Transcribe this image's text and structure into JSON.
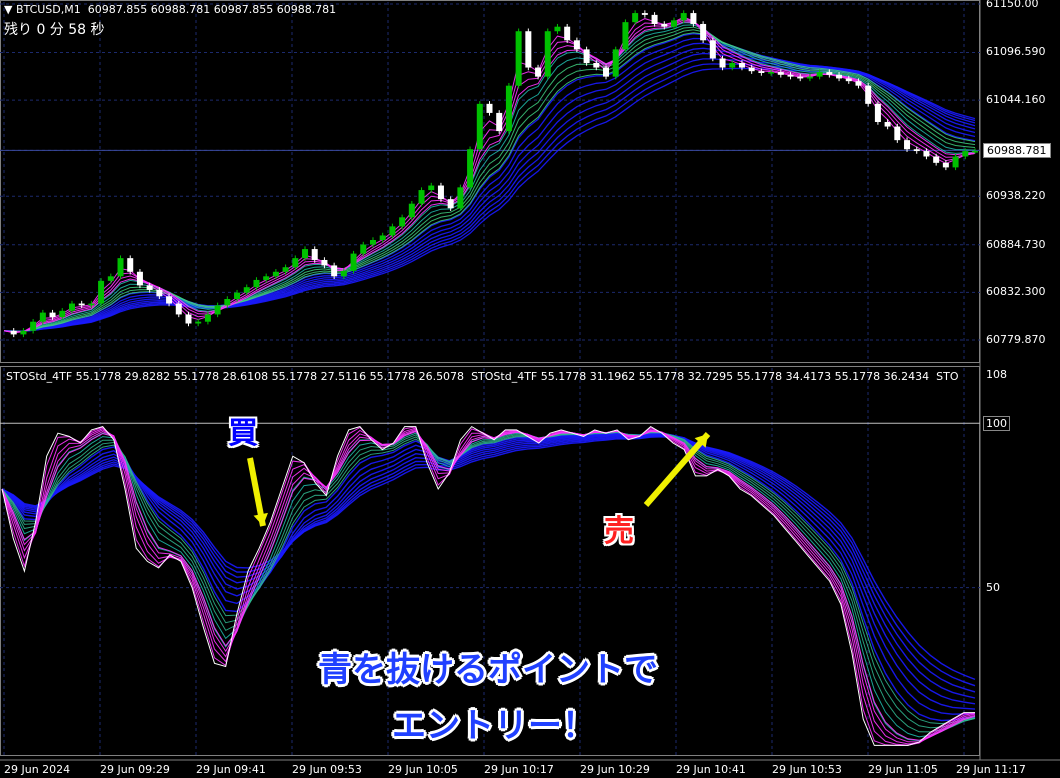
{
  "header": {
    "symbol": "▼ BTCUSD,M1",
    "ohlc": "60987.855 60988.781 60987.855 60988.781",
    "timer": "残り 0 分 58 秒"
  },
  "indicator": {
    "label1": "STOStd_4TF 55.1778 29.8282 55.1778 28.6108 55.1778 27.5116 55.1778 26.5078",
    "label2": "STOStd_4TF 55.1778 31.1962 55.1778 32.7295 55.1778 34.4173 55.1778 36.2434",
    "label3": "STO"
  },
  "annotations": {
    "buy": "買",
    "sell": "売",
    "caption_line1": "青を抜けるポイントで",
    "caption_line2": "エントリー！"
  },
  "colors": {
    "up_candle": "#00c000",
    "down_candle": "#ffffff",
    "blue_ribbon": "#1a1aff",
    "magenta": "#ff33ff",
    "teal": "#20c0b0",
    "grid": "#1c2a6e",
    "buy_arrow": "#f0f000",
    "sell_arrow": "#f0f000",
    "caption_fill": "#2040ff",
    "sell_text": "#ff2020"
  },
  "chart_data": [
    {
      "type": "candlestick",
      "title": "BTCUSD,M1",
      "ylim": [
        60760,
        61150
      ],
      "y_ticks": [
        "61150.00",
        "61096.590",
        "61044.160",
        "60988.781",
        "60938.220",
        "60884.730",
        "60832.300",
        "60779.870"
      ],
      "current_price": "60988.781",
      "x_ticks": [
        "29 Jun 2024",
        "29 Jun 09:29",
        "29 Jun 09:41",
        "29 Jun 09:53",
        "29 Jun 10:05",
        "29 Jun 10:17",
        "29 Jun 10:29",
        "29 Jun 10:41",
        "29 Jun 10:53",
        "29 Jun 11:05",
        "29 Jun 11:17"
      ],
      "close_path": [
        60790,
        60786,
        60790,
        60800,
        60810,
        60805,
        60812,
        60820,
        60818,
        60820,
        60845,
        60850,
        60870,
        60855,
        60840,
        60835,
        60828,
        60820,
        60808,
        60798,
        60800,
        60808,
        60818,
        60825,
        60832,
        60838,
        60846,
        60850,
        60855,
        60860,
        60870,
        60880,
        60868,
        60862,
        60850,
        60856,
        60875,
        60885,
        60890,
        60895,
        60905,
        60915,
        60930,
        60945,
        60950,
        60935,
        60925,
        60948,
        60990,
        61040,
        61030,
        61010,
        61060,
        61120,
        61080,
        61070,
        61120,
        61125,
        61110,
        61100,
        61085,
        61080,
        61070,
        61100,
        61130,
        61140,
        61138,
        61128,
        61125,
        61132,
        61140,
        61128,
        61110,
        61090,
        61080,
        61085,
        61080,
        61076,
        61074,
        61075,
        61072,
        61070,
        61068,
        61070,
        61075,
        61072,
        61068,
        61065,
        61060,
        61040,
        61020,
        61015,
        61000,
        60990,
        60988,
        60982,
        60975,
        60970,
        60982,
        60988,
        60988
      ]
    },
    {
      "type": "line",
      "title": "STOStd_4TF",
      "ylim": [
        0,
        108
      ],
      "y_ticks": [
        "108",
        "100",
        "50"
      ],
      "levels": [
        100,
        50
      ],
      "fast_path": [
        80,
        65,
        55,
        70,
        90,
        97,
        96,
        94,
        98,
        99,
        95,
        80,
        62,
        58,
        56,
        60,
        58,
        50,
        38,
        27,
        26,
        42,
        55,
        62,
        70,
        80,
        90,
        88,
        82,
        78,
        90,
        98,
        99,
        95,
        92,
        94,
        99,
        99,
        88,
        80,
        85,
        95,
        99,
        97,
        95,
        98,
        98,
        96,
        94,
        97,
        98,
        97,
        96,
        98,
        97,
        98,
        95,
        96,
        99,
        97,
        94,
        92,
        84,
        84,
        86,
        84,
        80,
        78,
        75,
        72,
        68,
        64,
        60,
        56,
        52,
        45,
        30,
        10,
        2,
        2,
        2,
        2,
        3,
        6,
        8,
        10,
        12,
        12
      ]
    }
  ]
}
